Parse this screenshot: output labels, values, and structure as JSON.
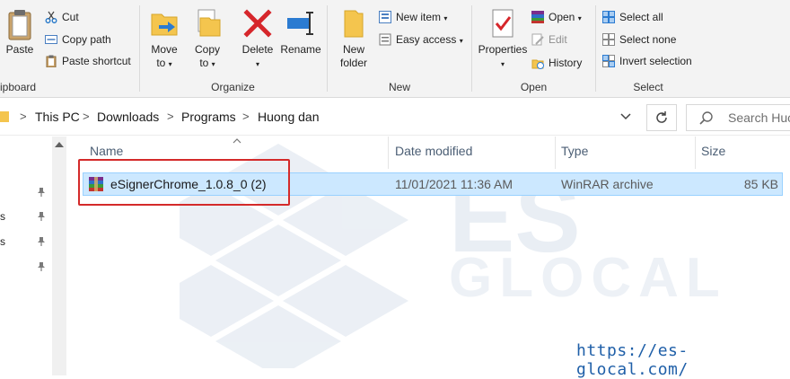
{
  "ribbon": {
    "clipboard": {
      "paste_label": "Paste",
      "cut_label": "Cut",
      "copy_path_label": "Copy path",
      "paste_shortcut_label": "Paste shortcut",
      "group_label": "ipboard"
    },
    "organize": {
      "move_to_line1": "Move",
      "move_to_line2": "to",
      "copy_to_line1": "Copy",
      "copy_to_line2": "to",
      "delete_label": "Delete",
      "rename_label": "Rename",
      "group_label": "Organize"
    },
    "new": {
      "new_folder_line1": "New",
      "new_folder_line2": "folder",
      "new_item_label": "New item",
      "easy_access_label": "Easy access",
      "group_label": "New"
    },
    "open": {
      "properties_label": "Properties",
      "open_label": "Open",
      "edit_label": "Edit",
      "history_label": "History",
      "group_label": "Open"
    },
    "select": {
      "select_all_label": "Select all",
      "select_none_label": "Select none",
      "invert_selection_label": "Invert selection",
      "group_label": "Select"
    }
  },
  "address": {
    "crumbs": [
      "This PC",
      "Downloads",
      "Programs",
      "Huong dan"
    ],
    "separator": ">",
    "refresh_icon": "refresh-icon",
    "search_placeholder": "Search Huo"
  },
  "columns": {
    "name": "Name",
    "date_modified": "Date modified",
    "type": "Type",
    "size": "Size"
  },
  "files": [
    {
      "name": "eSignerChrome_1.0.8_0 (2)",
      "date_modified": "11/01/2021 11:36 AM",
      "type": "WinRAR archive",
      "size": "85 KB",
      "icon": "winrar-archive-icon"
    }
  ],
  "nav": {
    "labels": [
      "s",
      "s"
    ]
  },
  "watermark": {
    "url": "https://es-glocal.com/",
    "logo_text_1": "ES",
    "logo_text_2": "GLOCAL"
  },
  "colors": {
    "selection_bg": "#cce8ff",
    "selection_border": "#99d1ff",
    "highlight_border": "#d42a2a",
    "url_color": "#1f5fa8"
  }
}
